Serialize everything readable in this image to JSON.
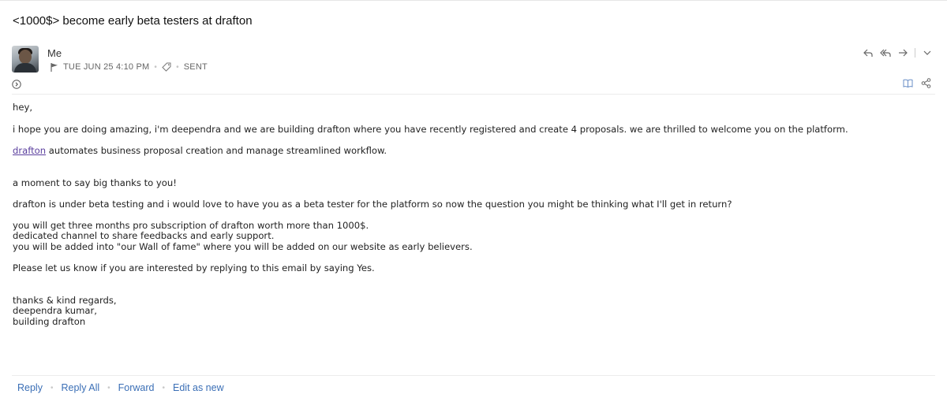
{
  "email": {
    "subject": "<1000$> become early beta testers at drafton",
    "sender": "Me",
    "date": "TUE JUN 25 4:10 PM",
    "status": "SENT",
    "body": {
      "greeting": "hey,",
      "para1": "i hope you are doing amazing, i'm deependra and we are building drafton where you have recently registered and create 4 proposals. we are thrilled to welcome you on the platform.",
      "link_text": "drafton",
      "para2_rest": " automates business proposal creation and manage streamlined workflow.",
      "para3": "a moment to say big thanks to you!",
      "para4": "drafton is under beta testing and i would love to have you as a beta tester for the platform so now the question you might be thinking what I'll get in return?",
      "benefits": [
        "you will get three months pro subscription of drafton worth more than 1000$.",
        "dedicated channel to share feedbacks and early support.",
        "you will be added into \"our Wall of fame\" where you will be added on our website as early believers."
      ],
      "para6": "Please let us know if you are interested by replying to this email by saying Yes.",
      "signature": [
        "thanks & kind regards,",
        "deependra kumar,",
        "building drafton"
      ]
    }
  },
  "icons": {
    "flag": "flag-icon",
    "tag": "tag-icon",
    "expand": "expand-icon",
    "reply": "reply-icon",
    "reply_all": "reply-all-icon",
    "forward": "forward-icon",
    "more": "chevron-down-icon",
    "read": "book-icon",
    "share": "share-icon"
  },
  "footer": {
    "reply": "Reply",
    "reply_all": "Reply All",
    "forward": "Forward",
    "edit_as_new": "Edit as new"
  },
  "colors": {
    "link": "#5b3f9e",
    "action_link": "#3b6fb6",
    "icon_accent": "#6a8fc7"
  }
}
